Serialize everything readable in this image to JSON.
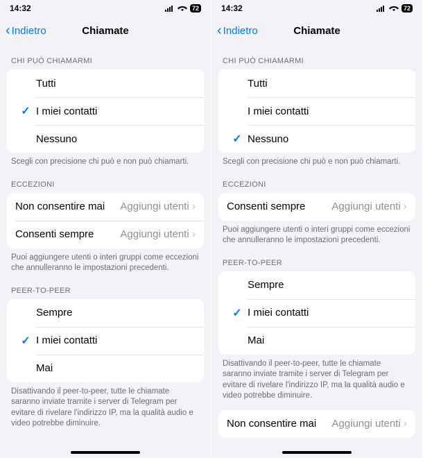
{
  "statusBar": {
    "time": "14:32",
    "battery": "72"
  },
  "nav": {
    "back": "Indietro",
    "title": "Chiamate"
  },
  "whoCanCall": {
    "header": "CHI PUÒ CHIAMARMI",
    "options": {
      "all": "Tutti",
      "contacts": "I miei contatti",
      "none": "Nessuno"
    },
    "footer": "Scegli con precisione chi può e non può chiamarti."
  },
  "exceptions": {
    "header": "ECCEZIONI",
    "neverAllow": "Non consentire mai",
    "alwaysAllow": "Consenti sempre",
    "addUsers": "Aggiungi utenti",
    "footer": "Puoi aggiungere utenti o interi gruppi come eccezioni che annulleranno le impostazioni precedenti."
  },
  "p2p": {
    "header": "PEER-TO-PEER",
    "options": {
      "always": "Sempre",
      "contacts": "I miei contatti",
      "never": "Mai"
    },
    "footer": "Disattivando il peer-to-peer, tutte le chiamate saranno inviate tramite i server di Telegram per evitare di rivelare l'indirizzo IP, ma la qualità audio e video potrebbe diminuire."
  }
}
